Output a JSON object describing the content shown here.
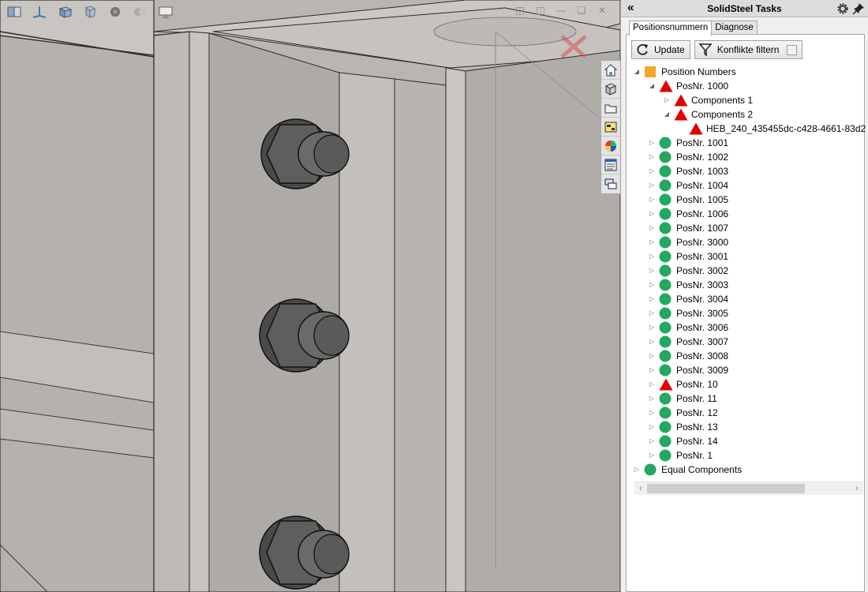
{
  "taskpane": {
    "collapse_glyph": "«",
    "title": "SolidSteel Tasks",
    "gear_icon": "gear-icon",
    "pin_icon": "pin-icon"
  },
  "tabs": [
    {
      "label": "Positionsnummern",
      "active": true
    },
    {
      "label": "Diagnose",
      "active": false
    }
  ],
  "buttons": {
    "update_label": "Update",
    "filter_label": "Konflikte filtern",
    "filter_checked": false
  },
  "tree": [
    {
      "label": "Position Numbers",
      "level": 0,
      "icon": "square",
      "expander": "open"
    },
    {
      "label": "PosNr. 1000",
      "level": 1,
      "icon": "triangle",
      "expander": "open"
    },
    {
      "label": "Components 1",
      "level": 2,
      "icon": "triangle",
      "expander": "closed"
    },
    {
      "label": "Components 2",
      "level": 2,
      "icon": "triangle",
      "expander": "open"
    },
    {
      "label": "HEB_240_435455dc-c428-4661-83d2",
      "level": 3,
      "icon": "triangle",
      "expander": "none"
    },
    {
      "label": "PosNr. 1001",
      "level": 1,
      "icon": "circle",
      "expander": "closed"
    },
    {
      "label": "PosNr. 1002",
      "level": 1,
      "icon": "circle",
      "expander": "closed"
    },
    {
      "label": "PosNr. 1003",
      "level": 1,
      "icon": "circle",
      "expander": "closed"
    },
    {
      "label": "PosNr. 1004",
      "level": 1,
      "icon": "circle",
      "expander": "closed"
    },
    {
      "label": "PosNr. 1005",
      "level": 1,
      "icon": "circle",
      "expander": "closed"
    },
    {
      "label": "PosNr. 1006",
      "level": 1,
      "icon": "circle",
      "expander": "closed"
    },
    {
      "label": "PosNr. 1007",
      "level": 1,
      "icon": "circle",
      "expander": "closed"
    },
    {
      "label": "PosNr. 3000",
      "level": 1,
      "icon": "circle",
      "expander": "closed"
    },
    {
      "label": "PosNr. 3001",
      "level": 1,
      "icon": "circle",
      "expander": "closed"
    },
    {
      "label": "PosNr. 3002",
      "level": 1,
      "icon": "circle",
      "expander": "closed"
    },
    {
      "label": "PosNr. 3003",
      "level": 1,
      "icon": "circle",
      "expander": "closed"
    },
    {
      "label": "PosNr. 3004",
      "level": 1,
      "icon": "circle",
      "expander": "closed"
    },
    {
      "label": "PosNr. 3005",
      "level": 1,
      "icon": "circle",
      "expander": "closed"
    },
    {
      "label": "PosNr. 3006",
      "level": 1,
      "icon": "circle",
      "expander": "closed"
    },
    {
      "label": "PosNr. 3007",
      "level": 1,
      "icon": "circle",
      "expander": "closed"
    },
    {
      "label": "PosNr. 3008",
      "level": 1,
      "icon": "circle",
      "expander": "closed"
    },
    {
      "label": "PosNr. 3009",
      "level": 1,
      "icon": "circle",
      "expander": "closed"
    },
    {
      "label": "PosNr. 10",
      "level": 1,
      "icon": "triangle",
      "expander": "closed"
    },
    {
      "label": "PosNr. 11",
      "level": 1,
      "icon": "circle",
      "expander": "closed"
    },
    {
      "label": "PosNr. 12",
      "level": 1,
      "icon": "circle",
      "expander": "closed"
    },
    {
      "label": "PosNr. 13",
      "level": 1,
      "icon": "circle",
      "expander": "closed"
    },
    {
      "label": "PosNr. 14",
      "level": 1,
      "icon": "circle",
      "expander": "closed"
    },
    {
      "label": "PosNr. 1",
      "level": 1,
      "icon": "circle",
      "expander": "closed"
    },
    {
      "label": "Equal Components",
      "level": 0,
      "icon": "circle",
      "expander": "closed"
    }
  ],
  "colors": {
    "ok": "#22a861",
    "conflict": "#e00000",
    "folder": "#f5a623",
    "viewport_bg": "#bdbab6"
  },
  "view_toolbar_icons": [
    "section-view-icon",
    "view-orientation-icon",
    "display-style-icon",
    "hide-show-icon",
    "appearance-icon",
    "scene-icon",
    "display-settings-icon"
  ],
  "side_tab_icons": [
    "home-icon",
    "parts-icon",
    "folder-icon",
    "properties-icon",
    "appearance-icon",
    "custom-properties-icon",
    "forum-icon"
  ]
}
